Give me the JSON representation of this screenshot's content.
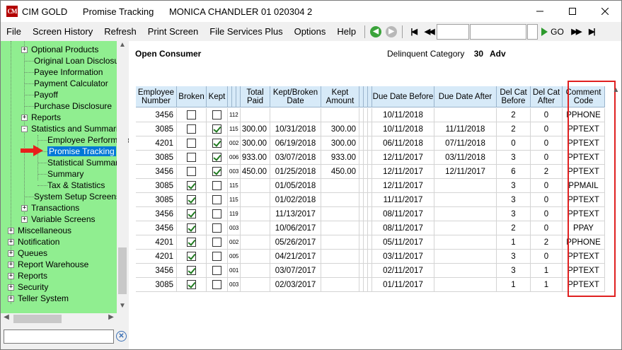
{
  "window": {
    "app_name": "CIM GOLD",
    "screen_name": "Promise Tracking",
    "customer": "MONICA CHANDLER  01 020304 2",
    "logo_text": "CM"
  },
  "menu": {
    "items": [
      "File",
      "Screen History",
      "Refresh",
      "Print Screen",
      "File Services Plus",
      "Options",
      "Help"
    ],
    "go_label": "GO"
  },
  "tree": {
    "items": [
      {
        "label": "Optional Products",
        "level": 1,
        "expander": "+"
      },
      {
        "label": "Original Loan Disclosure",
        "level": 1,
        "expander": ""
      },
      {
        "label": "Payee Information",
        "level": 1,
        "expander": ""
      },
      {
        "label": "Payment Calculator",
        "level": 1,
        "expander": ""
      },
      {
        "label": "Payoff",
        "level": 1,
        "expander": ""
      },
      {
        "label": "Purchase Disclosure",
        "level": 1,
        "expander": ""
      },
      {
        "label": "Reports",
        "level": 1,
        "expander": "+"
      },
      {
        "label": "Statistics and Summaries",
        "level": 1,
        "expander": "-"
      },
      {
        "label": "Employee Performanc",
        "level": 2,
        "expander": ""
      },
      {
        "label": "Promise Tracking",
        "level": 2,
        "expander": "",
        "selected": true
      },
      {
        "label": "Statistical Summary",
        "level": 2,
        "expander": ""
      },
      {
        "label": "Summary",
        "level": 2,
        "expander": ""
      },
      {
        "label": "Tax & Statistics",
        "level": 2,
        "expander": ""
      },
      {
        "label": "System Setup Screens",
        "level": 1,
        "expander": ""
      },
      {
        "label": "Transactions",
        "level": 1,
        "expander": "+"
      },
      {
        "label": "Variable Screens",
        "level": 1,
        "expander": "+"
      },
      {
        "label": "Miscellaneous",
        "level": 0,
        "expander": "+"
      },
      {
        "label": "Notification",
        "level": 0,
        "expander": "+"
      },
      {
        "label": "Queues",
        "level": 0,
        "expander": "+"
      },
      {
        "label": "Report Warehouse",
        "level": 0,
        "expander": "+"
      },
      {
        "label": "Reports",
        "level": 0,
        "expander": "+"
      },
      {
        "label": "Security",
        "level": 0,
        "expander": "+"
      },
      {
        "label": "Teller System",
        "level": 0,
        "expander": "+"
      }
    ],
    "search_value": ""
  },
  "header": {
    "title": "Open Consumer",
    "delinquent_label": "Delinquent Category",
    "delinquent_value": "30",
    "adv": "Adv"
  },
  "table": {
    "columns": [
      "Employee Number",
      "Broken",
      "Kept",
      "",
      "",
      "",
      "Total Paid",
      "Kept/Broken Date",
      "Kept Amount",
      "",
      "",
      "",
      "Due Date Before",
      "Due Date After",
      "Del Cat Before",
      "Del Cat After",
      "Comment Code"
    ],
    "rows": [
      {
        "emp": "3456",
        "broken": false,
        "kept": false,
        "misc": "112",
        "paid": "",
        "kbdate": "",
        "amount": "",
        "before": "10/11/2018",
        "after": "",
        "catb": "2",
        "cata": "0",
        "code": "PPHONE"
      },
      {
        "emp": "3085",
        "broken": false,
        "kept": true,
        "misc": "115",
        "paid": "300.00",
        "kbdate": "10/31/2018",
        "amount": "300.00",
        "before": "10/11/2018",
        "after": "11/11/2018",
        "catb": "2",
        "cata": "0",
        "code": "PPTEXT"
      },
      {
        "emp": "4201",
        "broken": false,
        "kept": true,
        "misc": "002",
        "paid": "300.00",
        "kbdate": "06/19/2018",
        "amount": "300.00",
        "before": "06/11/2018",
        "after": "07/11/2018",
        "catb": "0",
        "cata": "0",
        "code": "PPTEXT"
      },
      {
        "emp": "3085",
        "broken": false,
        "kept": true,
        "misc": "006",
        "paid": "933.00",
        "kbdate": "03/07/2018",
        "amount": "933.00",
        "before": "12/11/2017",
        "after": "03/11/2018",
        "catb": "3",
        "cata": "0",
        "code": "PPTEXT"
      },
      {
        "emp": "3456",
        "broken": false,
        "kept": true,
        "misc": "003",
        "paid": "450.00",
        "kbdate": "01/25/2018",
        "amount": "450.00",
        "before": "12/11/2017",
        "after": "12/11/2017",
        "catb": "6",
        "cata": "2",
        "code": "PPTEXT"
      },
      {
        "emp": "3085",
        "broken": true,
        "kept": false,
        "misc": "115",
        "paid": "",
        "kbdate": "01/05/2018",
        "amount": "",
        "before": "12/11/2017",
        "after": "",
        "catb": "3",
        "cata": "0",
        "code": "PPMAIL"
      },
      {
        "emp": "3085",
        "broken": true,
        "kept": false,
        "misc": "115",
        "paid": "",
        "kbdate": "01/02/2018",
        "amount": "",
        "before": "11/11/2017",
        "after": "",
        "catb": "3",
        "cata": "0",
        "code": "PPTEXT"
      },
      {
        "emp": "3456",
        "broken": true,
        "kept": false,
        "misc": "119",
        "paid": "",
        "kbdate": "11/13/2017",
        "amount": "",
        "before": "08/11/2017",
        "after": "",
        "catb": "3",
        "cata": "0",
        "code": "PPTEXT"
      },
      {
        "emp": "3456",
        "broken": true,
        "kept": false,
        "misc": "003",
        "paid": "",
        "kbdate": "10/06/2017",
        "amount": "",
        "before": "08/11/2017",
        "after": "",
        "catb": "2",
        "cata": "0",
        "code": "PPAY"
      },
      {
        "emp": "4201",
        "broken": true,
        "kept": false,
        "misc": "002",
        "paid": "",
        "kbdate": "05/26/2017",
        "amount": "",
        "before": "05/11/2017",
        "after": "",
        "catb": "1",
        "cata": "2",
        "code": "PPHONE"
      },
      {
        "emp": "4201",
        "broken": true,
        "kept": false,
        "misc": "005",
        "paid": "",
        "kbdate": "04/21/2017",
        "amount": "",
        "before": "03/11/2017",
        "after": "",
        "catb": "3",
        "cata": "0",
        "code": "PPTEXT"
      },
      {
        "emp": "3456",
        "broken": true,
        "kept": false,
        "misc": "001",
        "paid": "",
        "kbdate": "03/07/2017",
        "amount": "",
        "before": "02/11/2017",
        "after": "",
        "catb": "3",
        "cata": "1",
        "code": "PPTEXT"
      },
      {
        "emp": "3085",
        "broken": true,
        "kept": false,
        "misc": "003",
        "paid": "",
        "kbdate": "02/03/2017",
        "amount": "",
        "before": "01/11/2017",
        "after": "",
        "catb": "1",
        "cata": "1",
        "code": "PPTEXT"
      }
    ]
  },
  "colors": {
    "tree_bg": "#90ee90",
    "header_bg": "#d7eaf8",
    "selection": "#0078d7",
    "highlight": "#e02020"
  }
}
